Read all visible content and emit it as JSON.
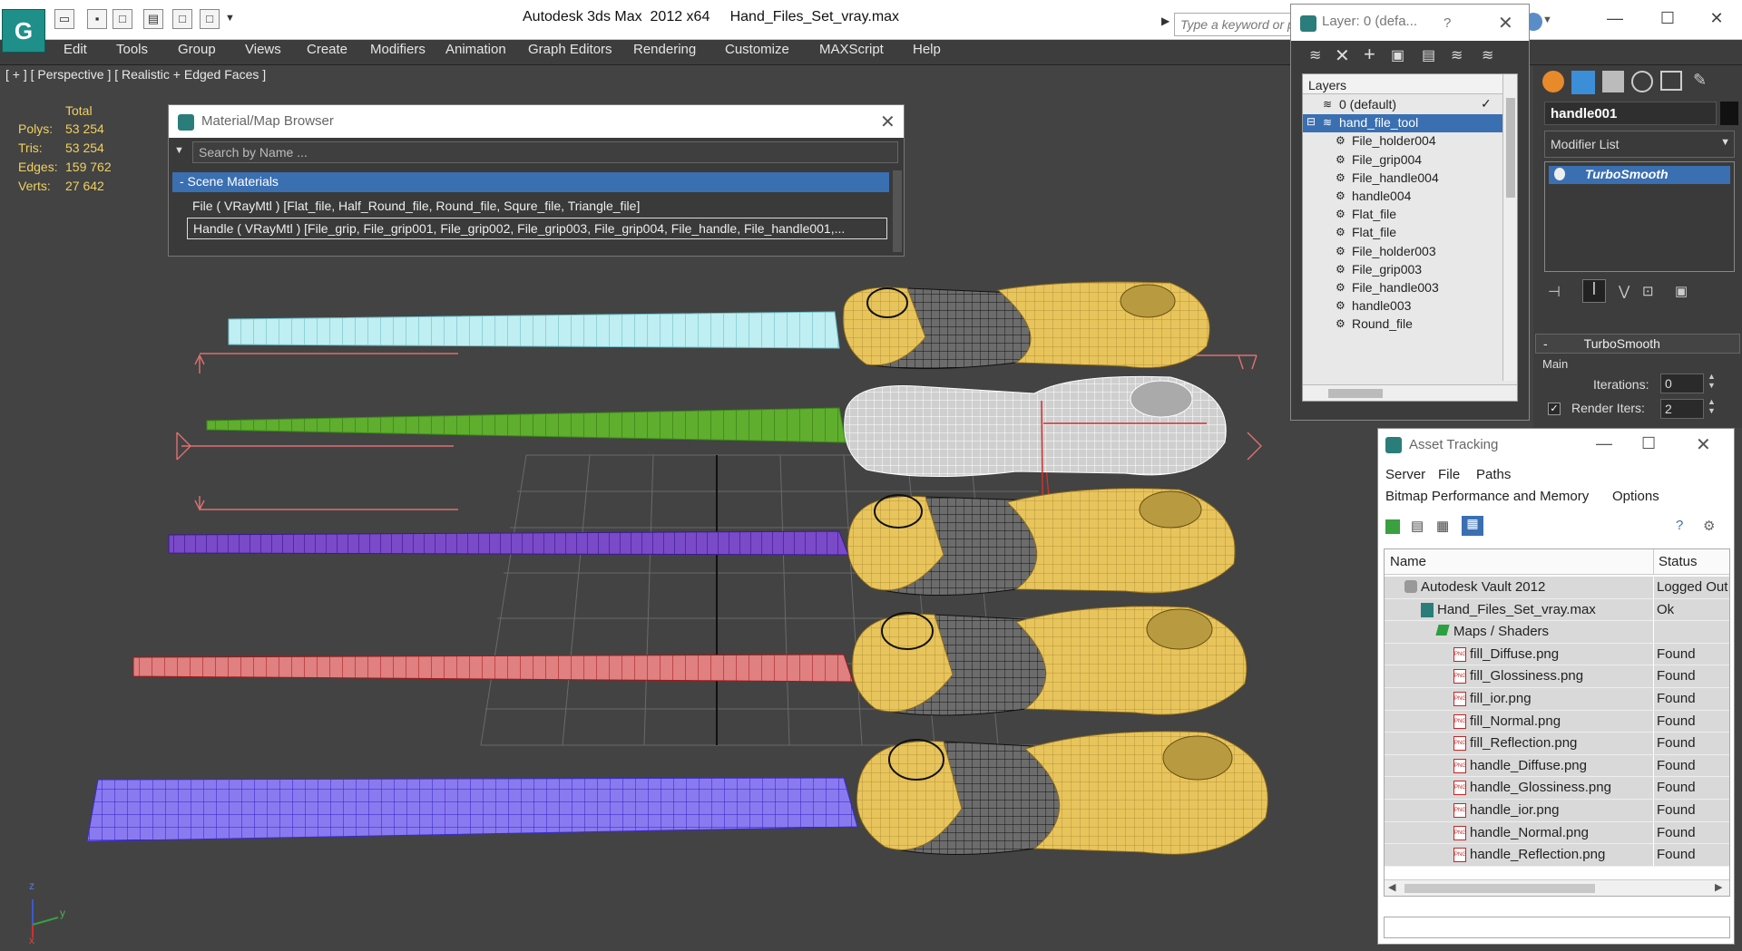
{
  "app": {
    "title": "Autodesk 3ds Max  2012 x64",
    "file": "Hand_Files_Set_vray.max",
    "logo": "G",
    "search_placeholder": "Type a keyword or p",
    "window_controls": [
      "—",
      "☐",
      "✕"
    ]
  },
  "menu": [
    "Edit",
    "Tools",
    "Group",
    "Views",
    "Create",
    "Modifiers",
    "Animation",
    "Graph Editors",
    "Rendering",
    "Customize",
    "MAXScript",
    "Help"
  ],
  "viewport": {
    "label": "[ + ] [ Perspective ] [ Realistic + Edged Faces ]",
    "stats": {
      "header": "Total",
      "rows": [
        {
          "k": "Polys:",
          "v": "53 254"
        },
        {
          "k": "Tris:",
          "v": "53 254"
        },
        {
          "k": "Edges:",
          "v": "159 762"
        },
        {
          "k": "Verts:",
          "v": "27 642"
        }
      ]
    },
    "axis": {
      "z": "z",
      "y": "y",
      "x": "x"
    }
  },
  "material_browser": {
    "title": "Material/Map Browser",
    "search_placeholder": "Search by Name ...",
    "section": "- Scene Materials",
    "rows": [
      "File  ( VRayMtl )  [Flat_file, Half_Round_file, Round_file, Squre_file, Triangle_file]",
      "Handle  ( VRayMtl )  [File_grip, File_grip001, File_grip002, File_grip003, File_grip004, File_handle, File_handle001,..."
    ]
  },
  "layer_panel": {
    "title": "Layer: 0 (defa...",
    "help": "?",
    "header": "Layers",
    "rows": [
      {
        "label": "0 (default)",
        "indent": 1,
        "type": "layer",
        "check": "✓"
      },
      {
        "label": "hand_file_tool",
        "indent": 1,
        "type": "layer",
        "selected": true,
        "expand": "⊟"
      },
      {
        "label": "File_holder004",
        "indent": 2,
        "type": "object"
      },
      {
        "label": "File_grip004",
        "indent": 2,
        "type": "object"
      },
      {
        "label": "File_handle004",
        "indent": 2,
        "type": "object"
      },
      {
        "label": "handle004",
        "indent": 2,
        "type": "object"
      },
      {
        "label": "Flat_file",
        "indent": 2,
        "type": "object"
      },
      {
        "label": "Flat_file",
        "indent": 2,
        "type": "object"
      },
      {
        "label": "File_holder003",
        "indent": 2,
        "type": "object"
      },
      {
        "label": "File_grip003",
        "indent": 2,
        "type": "object"
      },
      {
        "label": "File_handle003",
        "indent": 2,
        "type": "object"
      },
      {
        "label": "handle003",
        "indent": 2,
        "type": "object"
      },
      {
        "label": "Round_file",
        "indent": 2,
        "type": "object"
      }
    ]
  },
  "command_panel": {
    "object_name": "handle001",
    "modifier_list": "Modifier List",
    "stack_item": "TurboSmooth",
    "rollout": "TurboSmooth",
    "group": "Main",
    "iterations_label": "Iterations:",
    "iterations_value": "0",
    "render_iters_label": "Render Iters:",
    "render_iters_value": "2",
    "render_iters_checked": true
  },
  "asset_tracking": {
    "title": "Asset Tracking",
    "menu1": [
      "Server",
      "File",
      "Paths"
    ],
    "menu2": [
      "Bitmap Performance and Memory",
      "Options"
    ],
    "columns": [
      "Name",
      "Status"
    ],
    "rows": [
      {
        "name": "Autodesk Vault 2012",
        "status": "Logged Out",
        "indent": 0,
        "icon": "vault"
      },
      {
        "name": "Hand_Files_Set_vray.max",
        "status": "Ok",
        "indent": 1,
        "icon": "max"
      },
      {
        "name": "Maps / Shaders",
        "status": "",
        "indent": 2,
        "icon": "maps"
      },
      {
        "name": "fill_Diffuse.png",
        "status": "Found",
        "indent": 3,
        "icon": "png"
      },
      {
        "name": "fill_Glossiness.png",
        "status": "Found",
        "indent": 3,
        "icon": "png"
      },
      {
        "name": "fill_ior.png",
        "status": "Found",
        "indent": 3,
        "icon": "png"
      },
      {
        "name": "fill_Normal.png",
        "status": "Found",
        "indent": 3,
        "icon": "png"
      },
      {
        "name": "fill_Reflection.png",
        "status": "Found",
        "indent": 3,
        "icon": "png"
      },
      {
        "name": "handle_Diffuse.png",
        "status": "Found",
        "indent": 3,
        "icon": "png"
      },
      {
        "name": "handle_Glossiness.png",
        "status": "Found",
        "indent": 3,
        "icon": "png"
      },
      {
        "name": "handle_ior.png",
        "status": "Found",
        "indent": 3,
        "icon": "png"
      },
      {
        "name": "handle_Normal.png",
        "status": "Found",
        "indent": 3,
        "icon": "png"
      },
      {
        "name": "handle_Reflection.png",
        "status": "Found",
        "indent": 3,
        "icon": "png"
      }
    ]
  },
  "colors": {
    "accent": "#3a6fb2",
    "handle_yellow": "#e8c45c",
    "file_cyan": "#bfeff2",
    "file_green": "#5fae2e",
    "file_purple": "#5a2aa8",
    "file_red": "#c03030",
    "file_blue": "#7a6ae0",
    "stats_yellow": "#f0d060"
  }
}
